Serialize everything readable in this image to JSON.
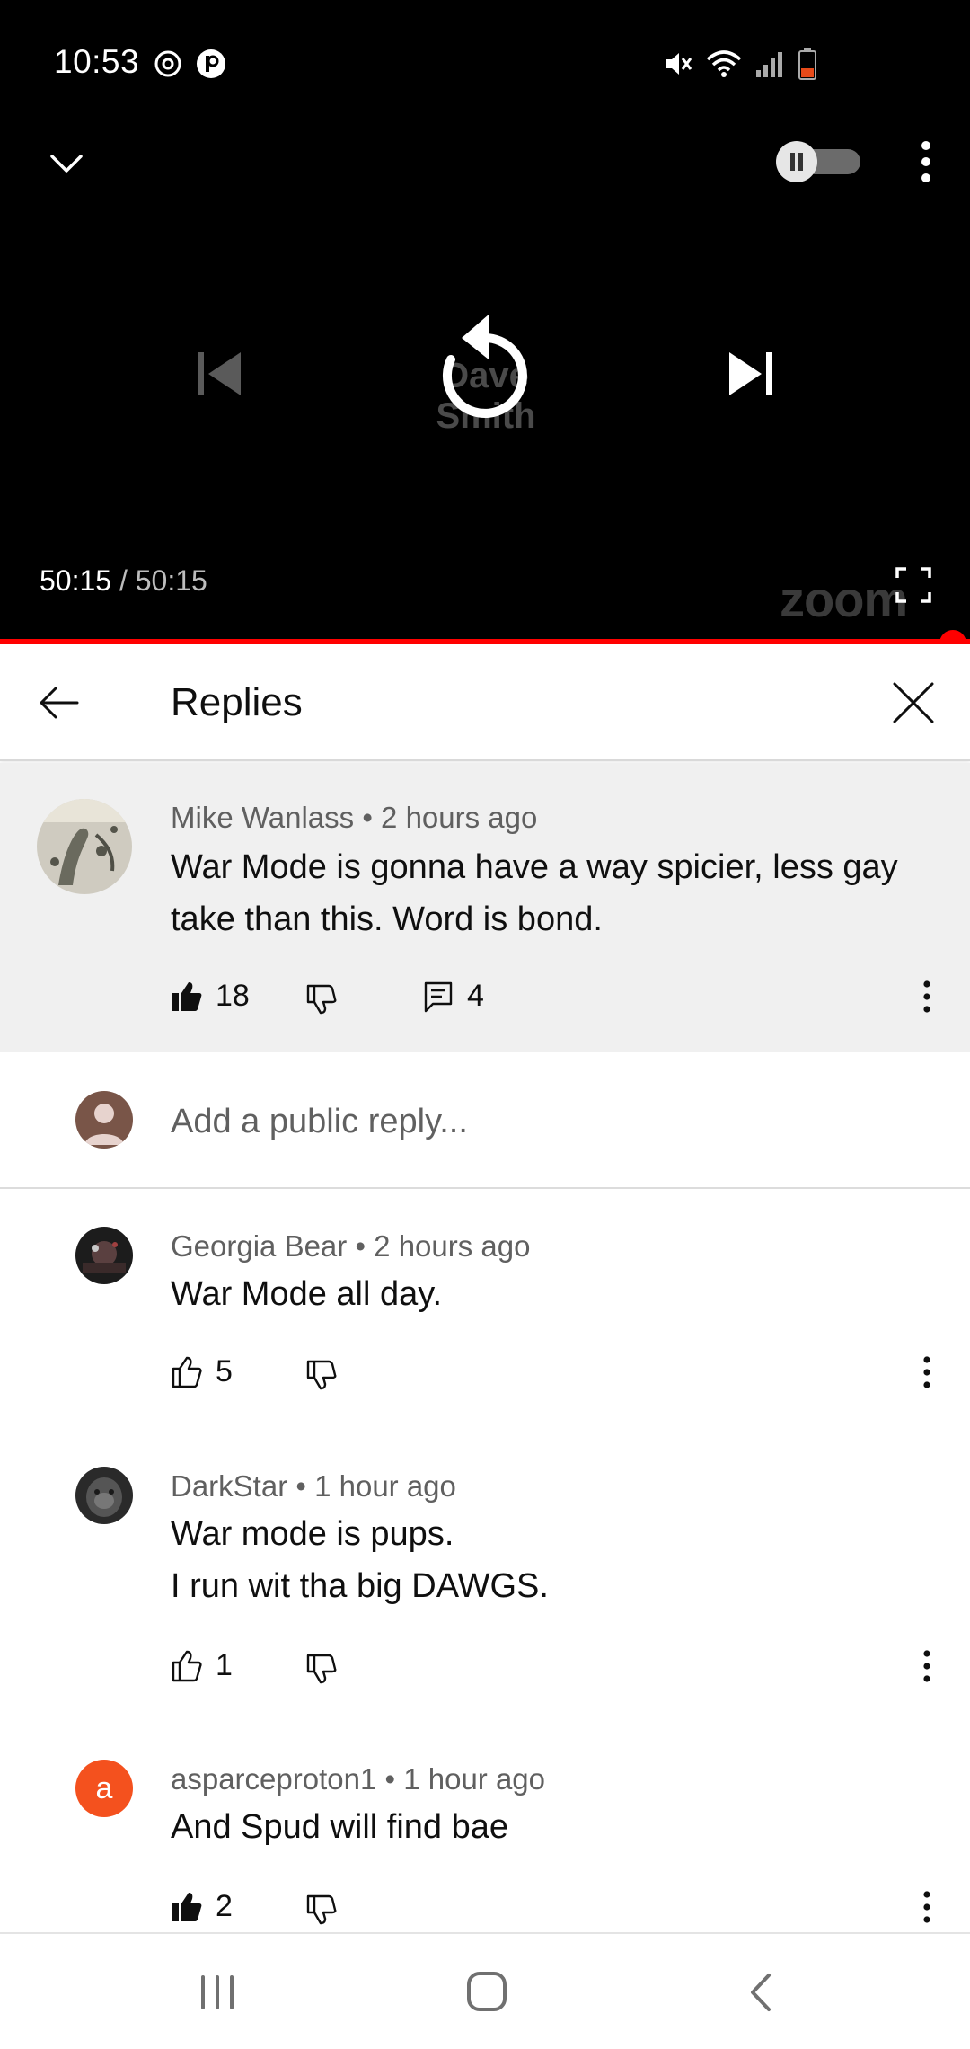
{
  "status_bar": {
    "time": "10:53",
    "icons": [
      "sync-icon",
      "app-p-icon",
      "mute-icon",
      "wifi-icon",
      "signal-icon",
      "battery-low-icon"
    ],
    "battery_color": "#e64a19"
  },
  "player": {
    "watermark": "Dave Smith",
    "brand_logo": "zoom",
    "current_time": "50:15",
    "separator": " / ",
    "total_time": "50:15",
    "progress_fraction": 1.0,
    "accent_color": "#ff0000",
    "autoplay_on": false
  },
  "replies_header": {
    "title": "Replies"
  },
  "main_comment": {
    "author": "Mike Wanlass",
    "time": "2 hours ago",
    "text": "War Mode is gonna have a way spicier, less gay\ntake than this. Word is bond.",
    "likes": "18",
    "liked": true,
    "reply_count": "4"
  },
  "add_reply": {
    "placeholder": "Add a public reply..."
  },
  "replies": [
    {
      "author": "Georgia Bear",
      "time": "2 hours ago",
      "text": "War Mode all day.",
      "likes": "5",
      "liked": false
    },
    {
      "author": "DarkStar",
      "time": "1 hour ago",
      "text": "War mode is pups.\nI run wit tha big DAWGS.",
      "likes": "1",
      "liked": false
    },
    {
      "author": "asparceproton1",
      "time": "1 hour ago",
      "text": "And Spud will find bae",
      "likes": "2",
      "liked": true,
      "avatar_letter": "a",
      "avatar_color": "#f4511e"
    }
  ],
  "meta_separator": " • "
}
